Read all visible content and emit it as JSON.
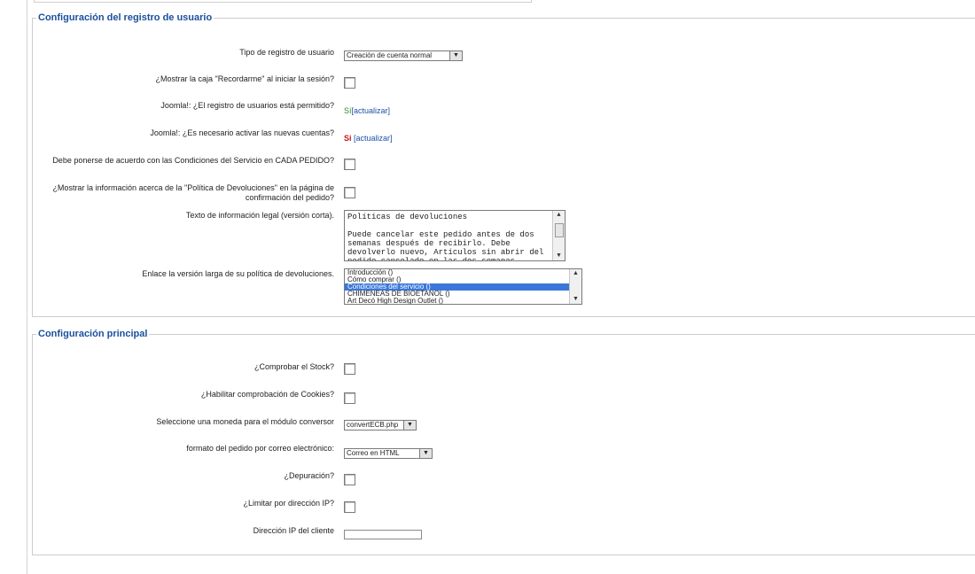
{
  "section1": {
    "legend": "Configuración del registro de usuario",
    "registration_type": {
      "label": "Tipo de registro de usuario",
      "value": "Creación de cuenta normal"
    },
    "remember_me": {
      "label": "¿Mostrar la caja \"Recordarme\" al iniciar la sesión?"
    },
    "registration_allowed": {
      "label": "Joomla!: ¿El registro de usuarios está permitido?",
      "value": "Sí",
      "link": "[actualizar]"
    },
    "activation_required": {
      "label": "Joomla!: ¿Es necesario activar las nuevas cuentas?",
      "value": "Si",
      "link": "[actualizar]"
    },
    "agree_tos": {
      "label": "Debe ponerse de acuerdo con las Condiciones del Servicio en CADA PEDIDO?"
    },
    "show_return_policy": {
      "label_1": "¿Mostrar la información acerca de la \"Política de Devoluciones\" en la página de",
      "label_2": "confirmación del pedido?"
    },
    "legal_info_short": {
      "label": "Texto de información legal (versión corta).",
      "value": "Políticas de devoluciones\n\nPuede cancelar este pedido antes de dos semanas después de recibirlo. Debe devolverlo nuevo, Artículos sin abrir del pedido cancelado en las dos semanas"
    },
    "return_policy_link": {
      "label": "Enlace la versión larga de su política de devoluciones.",
      "options": [
        "Introducción ()",
        "Cómo comprar ()",
        "Condiciones del servicio ()",
        "CHIMENEAS DE BIOETANOL ()",
        "Art Decó High Design Outlet ()"
      ],
      "selected_index": 2
    }
  },
  "section2": {
    "legend": "Configuración principal",
    "check_stock": {
      "label": "¿Comprobar el Stock?"
    },
    "cookie_check": {
      "label": "¿Habilitar comprobación de Cookies?"
    },
    "currency_module": {
      "label": "Seleccione una moneda para el módulo conversor",
      "value": "convertECB.php"
    },
    "email_format": {
      "label": "formato del pedido por correo electrónico:",
      "value": "Correo en HTML"
    },
    "debug": {
      "label": "¿Depuración?"
    },
    "limit_ip": {
      "label": "¿Limitar por dirección IP?"
    },
    "client_ip": {
      "label": "Dirección IP del cliente",
      "value": ""
    }
  },
  "icons": {
    "dropdown_arrow": "▼",
    "scroll_up": "▲",
    "scroll_down": "▼"
  }
}
